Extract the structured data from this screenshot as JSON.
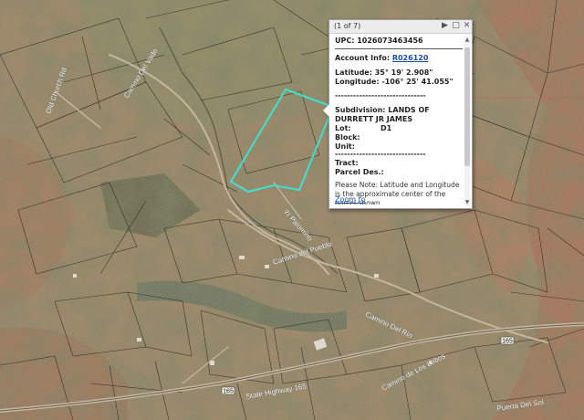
{
  "map": {
    "parcel_color": "#3fe0d0",
    "road_labels": [
      "Camino Del Vado",
      "Old Church Rd",
      "Yr Palomino",
      "State Highway 165",
      "Camino del Pueblo",
      "Camino Del Rio",
      "Camino de Los Lobos",
      "Puerta Del Sol"
    ],
    "shield_labels": [
      "165",
      "165"
    ]
  },
  "popup": {
    "page_count": "(1 of 7)",
    "upc": "UPC: 1026073463456",
    "account_label": "Account Info:",
    "account_link": "R026120",
    "latitude": "Latitude: 35° 19' 2.908\"",
    "longitude": "Longitude: -106° 25' 41.055\"",
    "separator": "------------------------------",
    "subdivision": "Subdivision: LANDS OF DURRETT JR JAMES",
    "lot_label": "Lot:",
    "lot_value": "D1",
    "block_label": "Block:",
    "unit_label": "Unit:",
    "tract_label": "Tract:",
    "parcel_label": "Parcel Des.:",
    "note": "Please Note: Latitude and Longitude is the approximate center of the parcel shown.",
    "zoom_link": "Zoom to"
  }
}
